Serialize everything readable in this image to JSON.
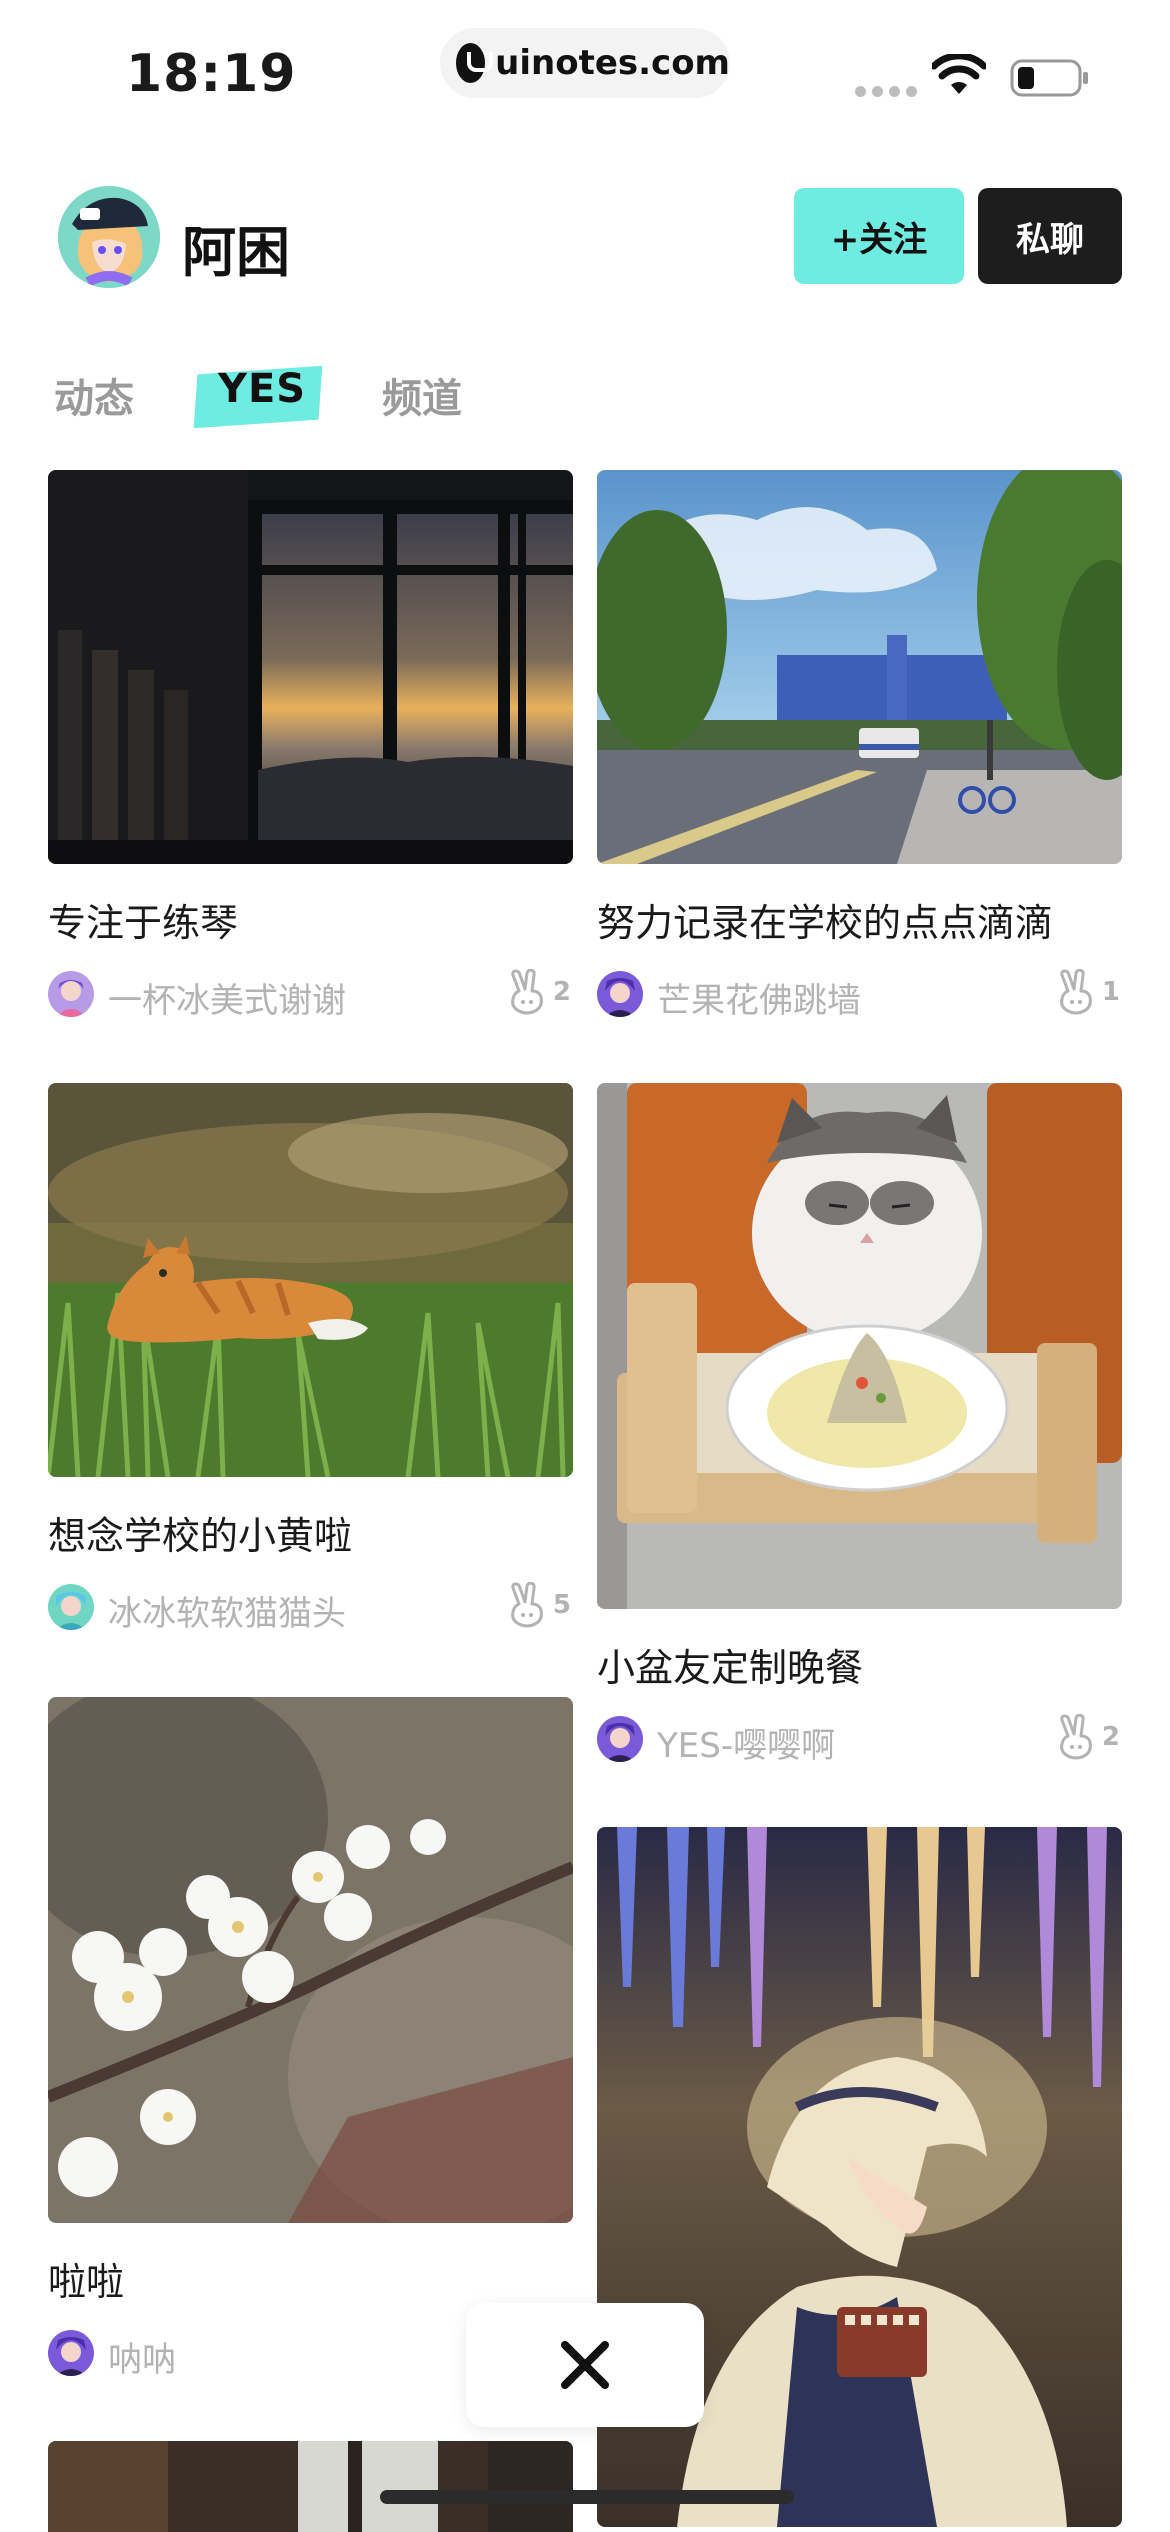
{
  "status_bar": {
    "time": "18:19",
    "url": "uinotes.com"
  },
  "profile": {
    "name": "阿困",
    "follow_label": "+关注",
    "chat_label": "私聊"
  },
  "tabs": [
    {
      "label": "动态"
    },
    {
      "label": "YES",
      "active": true
    },
    {
      "label": "频道"
    }
  ],
  "cards": [
    {
      "title": "专注于练琴",
      "author": "一杯冰美式谢谢",
      "likes": "2"
    },
    {
      "title": "努力记录在学校的点点滴滴",
      "author": "芒果花佛跳墙",
      "likes": "1"
    },
    {
      "title": "想念学校的小黄啦",
      "author": "冰冰软软猫猫头",
      "likes": "5"
    },
    {
      "title": "小盆友定制晚餐",
      "author": "YES-嘤嘤啊",
      "likes": "2"
    },
    {
      "title": "啦啦",
      "author": "呐呐",
      "likes": ""
    }
  ],
  "colors": {
    "accent": "#6fece2",
    "dark_button": "#1d1d1d",
    "muted_text": "#b3b3b3"
  },
  "icons": [
    "lock-icon",
    "wifi-icon",
    "battery-icon",
    "victory-hand-icon",
    "close-icon"
  ]
}
